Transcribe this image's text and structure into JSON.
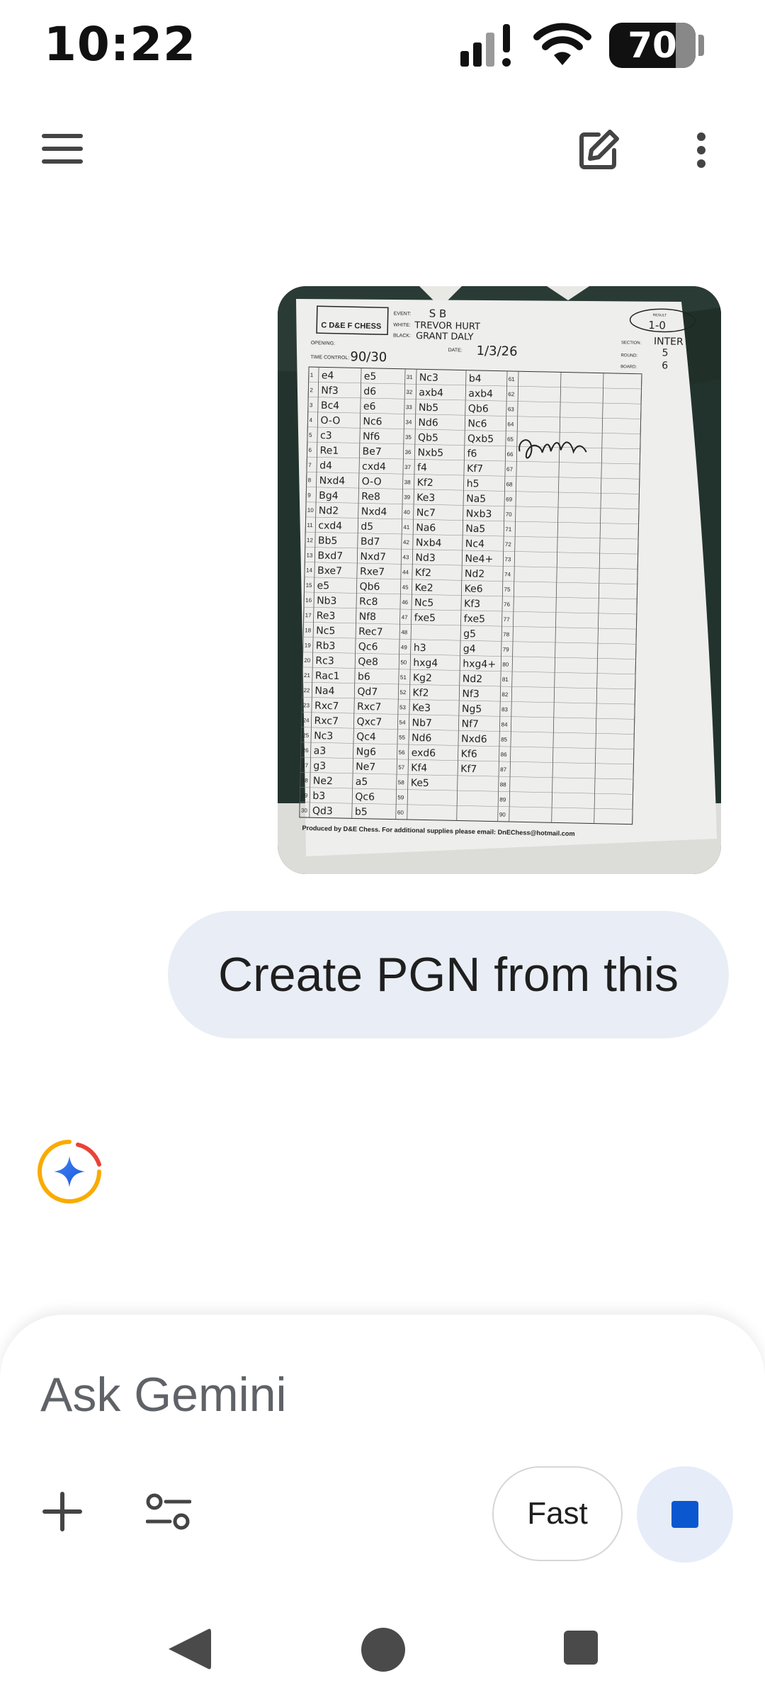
{
  "status_bar": {
    "time": "10:22",
    "battery": "70",
    "icons": [
      "signal-icon",
      "wifi-icon",
      "battery-icon"
    ]
  },
  "app_bar": {
    "icons": [
      "menu-icon",
      "edit-icon",
      "more-vert-icon"
    ]
  },
  "scoresheet": {
    "logo_text": "C D&E F CHESS",
    "event_label": "EVENT:",
    "event": "S B",
    "white_label": "WHITE:",
    "white": "TREVOR HURT",
    "black_label": "BLACK:",
    "black": "GRANT DALY",
    "opening_label": "OPENING:",
    "date_label": "DATE:",
    "date": "1/3/26",
    "time_control_label": "TIME CONTROL:",
    "time_control": "90/30",
    "result_label": "RESULT",
    "result": "1-0",
    "section_label": "SECTION:",
    "section": "INTER",
    "round_label": "ROUND:",
    "round": "5",
    "board_label": "BOARD:",
    "board": "6",
    "signature": "Grant Daly",
    "footer": "Produced by D&E Chess. For additional supplies please email: DnEChess@hotmail.com",
    "moves": [
      [
        "e4",
        "e5"
      ],
      [
        "Nf3",
        "d6"
      ],
      [
        "Bc4",
        "e6"
      ],
      [
        "O-O",
        "Nc6"
      ],
      [
        "c3",
        "Nf6"
      ],
      [
        "Re1",
        "Be7"
      ],
      [
        "d4",
        "cxd4"
      ],
      [
        "Nxd4",
        "O-O"
      ],
      [
        "Bg4",
        "Re8"
      ],
      [
        "Nd2",
        "Nxd4"
      ],
      [
        "cxd4",
        "d5"
      ],
      [
        "Bb5",
        "Bd7"
      ],
      [
        "Bxd7",
        "Nxd7"
      ],
      [
        "Bxe7",
        "Rxe7"
      ],
      [
        "e5",
        "Qb6"
      ],
      [
        "Nb3",
        "Rc8"
      ],
      [
        "Re3",
        "Nf8"
      ],
      [
        "Nc5",
        "Rec7"
      ],
      [
        "Rb3",
        "Qc6"
      ],
      [
        "Rc3",
        "Qe8"
      ],
      [
        "Rac1",
        "b6"
      ],
      [
        "Na4",
        "Qd7"
      ],
      [
        "Rxc7",
        "Rxc7"
      ],
      [
        "Rxc7",
        "Qxc7"
      ],
      [
        "Nc3",
        "Qc4"
      ],
      [
        "a3",
        "Ng6"
      ],
      [
        "g3",
        "Ne7"
      ],
      [
        "Ne2",
        "a5"
      ],
      [
        "b3",
        "Qc6"
      ],
      [
        "Qd3",
        "b5"
      ],
      [
        "Nc3",
        "b4"
      ],
      [
        "axb4",
        "axb4"
      ],
      [
        "Nb5",
        "Qb6"
      ],
      [
        "Nd6",
        "Nc6"
      ],
      [
        "Qb5",
        "Qxb5"
      ],
      [
        "Nxb5",
        "f6"
      ],
      [
        "f4",
        "Kf7"
      ],
      [
        "Kf2",
        "h5"
      ],
      [
        "Ke3",
        "Na5"
      ],
      [
        "Nc7",
        "Nxb3"
      ],
      [
        "Na6",
        "Na5"
      ],
      [
        "Nxb4",
        "Nc4"
      ],
      [
        "Nd3",
        "Ne4+"
      ],
      [
        "Kf2",
        "Nd2"
      ],
      [
        "Ke2",
        "Ke6"
      ],
      [
        "Nc5",
        "Kf3"
      ],
      [
        "fxe5",
        "fxe5"
      ],
      [
        "",
        "g5"
      ],
      [
        "h3",
        "g4"
      ],
      [
        "hxg4",
        "hxg4+"
      ],
      [
        "Kg2",
        "Nd2"
      ],
      [
        "Kf2",
        "Nf3"
      ],
      [
        "Ke3",
        "Ng5"
      ],
      [
        "Nb7",
        "Nf7"
      ],
      [
        "Nd6",
        "Nxd6"
      ],
      [
        "exd6",
        "Kf6"
      ],
      [
        "Kf4",
        "Kf7"
      ],
      [
        "Ke5",
        ""
      ],
      [
        "",
        ""
      ],
      [
        "",
        ""
      ]
    ]
  },
  "message": {
    "text": "Create PGN from this"
  },
  "input": {
    "placeholder": "Ask Gemini",
    "fast_label": "Fast"
  }
}
